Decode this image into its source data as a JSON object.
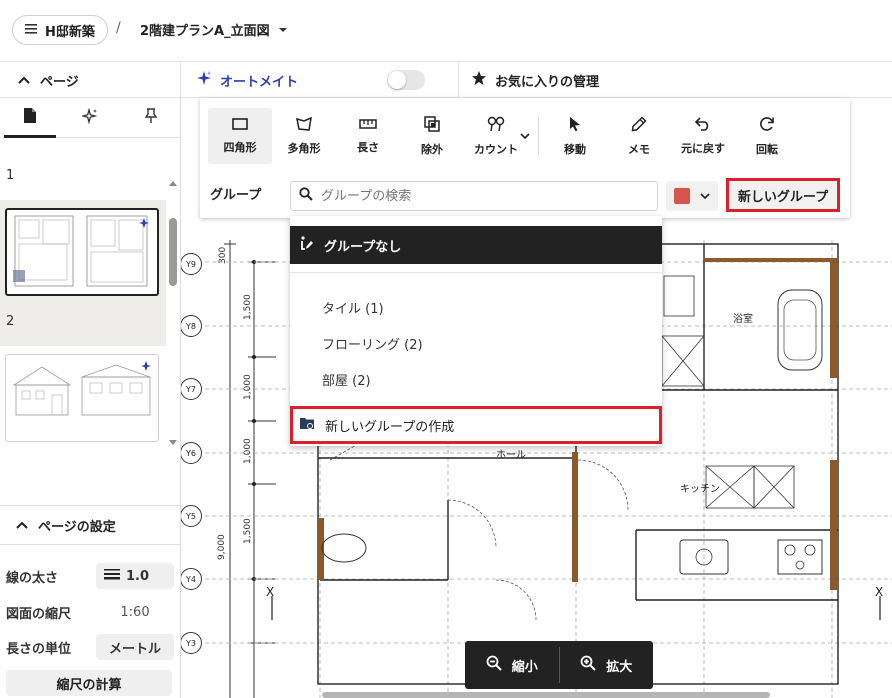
{
  "header": {
    "project_name": "H邸新築",
    "separator": "/",
    "file_name": "2階建プランA_立面図"
  },
  "subheader": {
    "pages_label": "ページ",
    "automate_label": "オートメイト",
    "favorites_label": "お気に入りの管理"
  },
  "sidebar": {
    "pages": [
      {
        "number": "1"
      },
      {
        "number": "2"
      }
    ],
    "settings_title": "ページの設定",
    "settings": [
      {
        "label": "線の太さ",
        "value": "1.0"
      },
      {
        "label": "図面の縮尺",
        "value": "1:60"
      },
      {
        "label": "長さの単位",
        "value": "メートル"
      }
    ],
    "calc_button": "縮尺の計算"
  },
  "toolbar": {
    "tools": [
      {
        "label": "四角形",
        "icon": "rectangle-icon"
      },
      {
        "label": "多角形",
        "icon": "polygon-icon"
      },
      {
        "label": "長さ",
        "icon": "ruler-icon"
      },
      {
        "label": "除外",
        "icon": "exclude-icon"
      },
      {
        "label": "カウント",
        "icon": "count-icon"
      },
      {
        "label": "移動",
        "icon": "cursor-icon"
      },
      {
        "label": "メモ",
        "icon": "pen-icon"
      },
      {
        "label": "元に戻す",
        "icon": "undo-icon"
      },
      {
        "label": "回転",
        "icon": "rotate-icon"
      }
    ],
    "group_label": "グループ",
    "search_placeholder": "グループの検索",
    "group_color": "#d9534f",
    "new_group_button": "新しいグループ"
  },
  "dropdown": {
    "header": "グループなし",
    "items": [
      "タイル (1)",
      "フローリング (2)",
      "部屋 (2)"
    ],
    "create_label": "新しいグループの作成"
  },
  "drawing": {
    "axes": [
      "Y9",
      "Y8",
      "Y7",
      "Y6",
      "Y5",
      "Y4",
      "Y3"
    ],
    "dimensions": [
      "300",
      "1,500",
      "1,000",
      "1,000",
      "1,500",
      "9,000"
    ],
    "rooms": [
      "浴室",
      "ホール",
      "キッチン"
    ],
    "marks": [
      "X",
      "X"
    ]
  },
  "zoom": {
    "zoom_out": "縮小",
    "zoom_in": "拡大"
  },
  "colors": {
    "highlight": "#d8212d",
    "accent": "#2f3fb0"
  }
}
